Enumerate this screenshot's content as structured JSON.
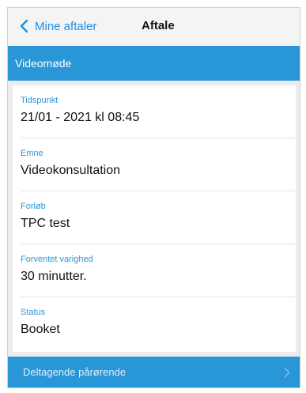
{
  "navbar": {
    "back_label": "Mine aftaler",
    "title": "Aftale"
  },
  "section": {
    "title": "Videomøde"
  },
  "fields": [
    {
      "label": "Tidspunkt",
      "value": "21/01 - 2021 kl 08:45"
    },
    {
      "label": "Emne",
      "value": "Videokonsultation"
    },
    {
      "label": "Forløb",
      "value": "TPC test"
    },
    {
      "label": "Forventet varighed",
      "value": "30 minutter."
    },
    {
      "label": "Status",
      "value": "Booket"
    }
  ],
  "footer": {
    "label": "Deltagende pårørende"
  },
  "icons": {
    "back": "chevron-left-icon",
    "footer": "chevron-right-icon"
  },
  "colors": {
    "accent": "#2996d8",
    "link": "#1e8fe0",
    "background": "#ececec"
  }
}
